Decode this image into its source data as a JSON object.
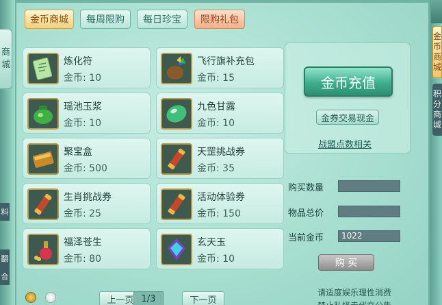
{
  "left_edge": {
    "tab_text": [
      "商",
      "城"
    ],
    "frag1": "料",
    "frag2": "翻",
    "frag3": "合"
  },
  "tabs": [
    {
      "label": "金币商城",
      "state": "active"
    },
    {
      "label": "每周限购",
      "state": "normal"
    },
    {
      "label": "每日珍宝",
      "state": "normal"
    },
    {
      "label": "限购礼包",
      "state": "special"
    }
  ],
  "items": [
    {
      "name": "炼化符",
      "price": "金币: 10",
      "icon": "talisman-icon"
    },
    {
      "name": "飞行旗补充包",
      "price": "金币: 15",
      "icon": "flag-bag-icon"
    },
    {
      "name": "瑶池玉浆",
      "price": "金币: 10",
      "icon": "jade-jar-icon"
    },
    {
      "name": "九色甘露",
      "price": "金币: 10",
      "icon": "green-gem-icon"
    },
    {
      "name": "聚宝盒",
      "price": "金币: 500",
      "icon": "treasure-box-icon"
    },
    {
      "name": "天罡挑战券",
      "price": "金币: 35",
      "icon": "scroll-icon"
    },
    {
      "name": "生肖挑战券",
      "price": "金币: 25",
      "icon": "scroll-icon"
    },
    {
      "name": "活动体验券",
      "price": "金币: 150",
      "icon": "scroll-icon"
    },
    {
      "name": "福泽苍生",
      "price": "金币: 80",
      "icon": "potion-icon"
    },
    {
      "name": "玄天玉",
      "price": "金币: 10",
      "icon": "blue-gem-icon"
    }
  ],
  "right_panel": {
    "recharge": "金币充值",
    "exchange": "金券交易现金",
    "league": "战盟点数相关"
  },
  "form": {
    "qty_label": "购买数量",
    "qty_value": "",
    "total_label": "物品总价",
    "total_value": "",
    "current_label": "当前金币",
    "current_value": "1022",
    "buy": "购 买"
  },
  "notice": {
    "line1": "请适度娱乐理性消费",
    "line2": "禁止私怪走代充公告"
  },
  "pagination": {
    "prev": "上一页",
    "indicator": "1/3",
    "next": "下一页"
  },
  "right_edge": {
    "tab1": [
      "金",
      "币",
      "商",
      "城"
    ],
    "tab2": [
      "积",
      "分",
      "商",
      "城"
    ]
  },
  "colors": {
    "accent_gold": "#f5cf7c",
    "accent_green": "#3fae8d",
    "panel_bg": "#a8dfd1"
  }
}
